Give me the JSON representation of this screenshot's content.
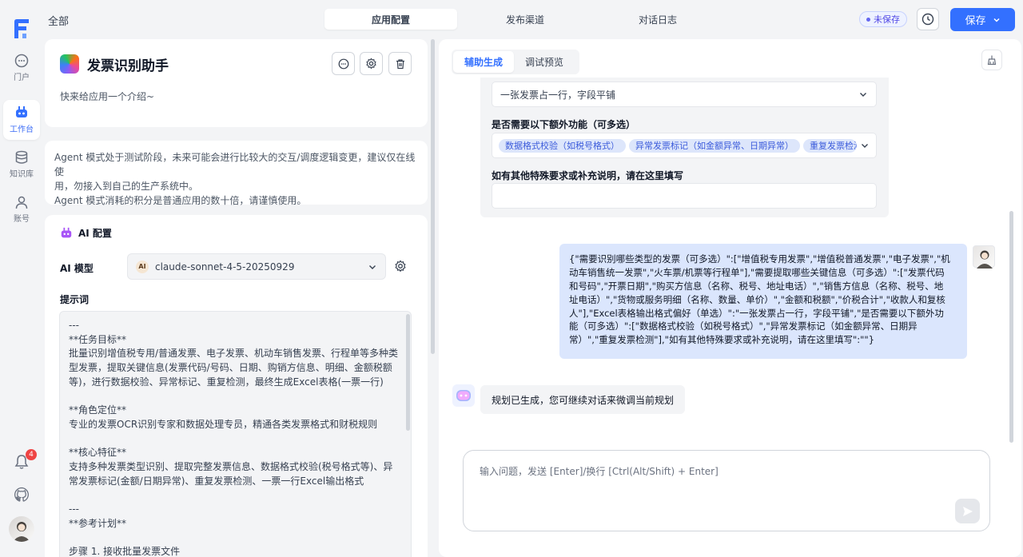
{
  "rail": {
    "items": [
      {
        "label": "门户",
        "icon": "chat-bubble-icon"
      },
      {
        "label": "工作台",
        "icon": "robot-icon"
      },
      {
        "label": "知识库",
        "icon": "database-icon"
      },
      {
        "label": "账号",
        "icon": "user-icon"
      }
    ],
    "notification_count": "4"
  },
  "header": {
    "breadcrumb": "全部",
    "tabs": [
      "应用配置",
      "发布渠道",
      "对话日志"
    ],
    "unsaved": "未保存",
    "save_label": "保存"
  },
  "app": {
    "name": "发票识别助手",
    "intro": "快来给应用一个介绍~"
  },
  "warning": {
    "line1": "Agent 模式处于测试阶段，未来可能会进行比较大的交互/调度逻辑变更，建议仅在线使",
    "line2": "用，勿接入到自己的生产系统中。",
    "line3": "Agent 模式消耗的积分是普通应用的数十倍，请谨慎使用。"
  },
  "ai_config": {
    "title": "AI 配置",
    "model_label": "AI 模型",
    "model_badge": "AI",
    "model_value": "claude-sonnet-4-5-20250929",
    "prompt_label": "提示词",
    "prompt_lines": [
      "---",
      "**任务目标**",
      "批量识别增值税专用/普通发票、电子发票、机动车销售发票、行程单等多种类",
      "型发票，提取关键信息(发票代码/号码、日期、购销方信息、明细、金额税额",
      "等)，进行数据校验、异常标记、重复检测，最终生成Excel表格(一票一行)",
      "",
      "**角色定位**",
      "专业的发票OCR识别专家和数据处理专员，精通各类发票格式和财税规则",
      "",
      "**核心特征**",
      "支持多种发票类型识别、提取完整发票信息、数据格式校验(税号格式等)、异",
      "常发票标记(金额/日期异常)、重复发票检测、一票一行Excel输出格式",
      "",
      "---",
      "**参考计划**",
      "",
      "步骤 1. 接收批量发票文件"
    ]
  },
  "right": {
    "tabs": [
      "辅助生成",
      "调试预览"
    ],
    "form": {
      "select_value": "一张发票占一行，字段平铺",
      "extra_label": "是否需要以下额外功能（可多选）",
      "extra_tags": [
        "数据格式校验（如税号格式）",
        "异常发票标记（如金额异常、日期异常）",
        "重复发票检测"
      ],
      "other_label": "如有其他特殊要求或补充说明，请在这里填写",
      "other_value": ""
    },
    "user_message_lines": [
      "{\"需要识别哪些类型的发票（可多选）\":[\"增值税专用发票\",\"增值税普通发票\",\"电子发票\",\"机",
      "动车销售统一发票\",\"火车票/机票等行程单\"],\"需要提取哪些关键信息（可多选）\":[\"发票代码",
      "和号码\",\"开票日期\",\"购买方信息（名称、税号、地址电话）\",\"销售方信息（名称、税号、地",
      "址电话）\",\"货物或服务明细（名称、数量、单价）\",\"金额和税额\",\"价税合计\",\"收款人和复核",
      "人\"],\"Excel表格输出格式偏好（单选）\":\"一张发票占一行，字段平铺\",\"是否需要以下额外功",
      "能（可多选）\":[\"数据格式校验（如税号格式）\",\"异常发票标记（如金额异常、日期异",
      "常）\",\"重复发票检测\"],\"如有其他特殊要求或补充说明，请在这里填写\":\"\"}"
    ],
    "bot_message": "规划已生成，您可继续对话来微调当前规划",
    "input_placeholder": "输入问题，发送 [Enter]/换行 [Ctrl(Alt/Shift) + Enter]"
  },
  "colors": {
    "primary": "#3370ff",
    "tag_bg": "#dde6fb",
    "user_bubble": "#dbe6fd",
    "badge": "#ef4444"
  }
}
